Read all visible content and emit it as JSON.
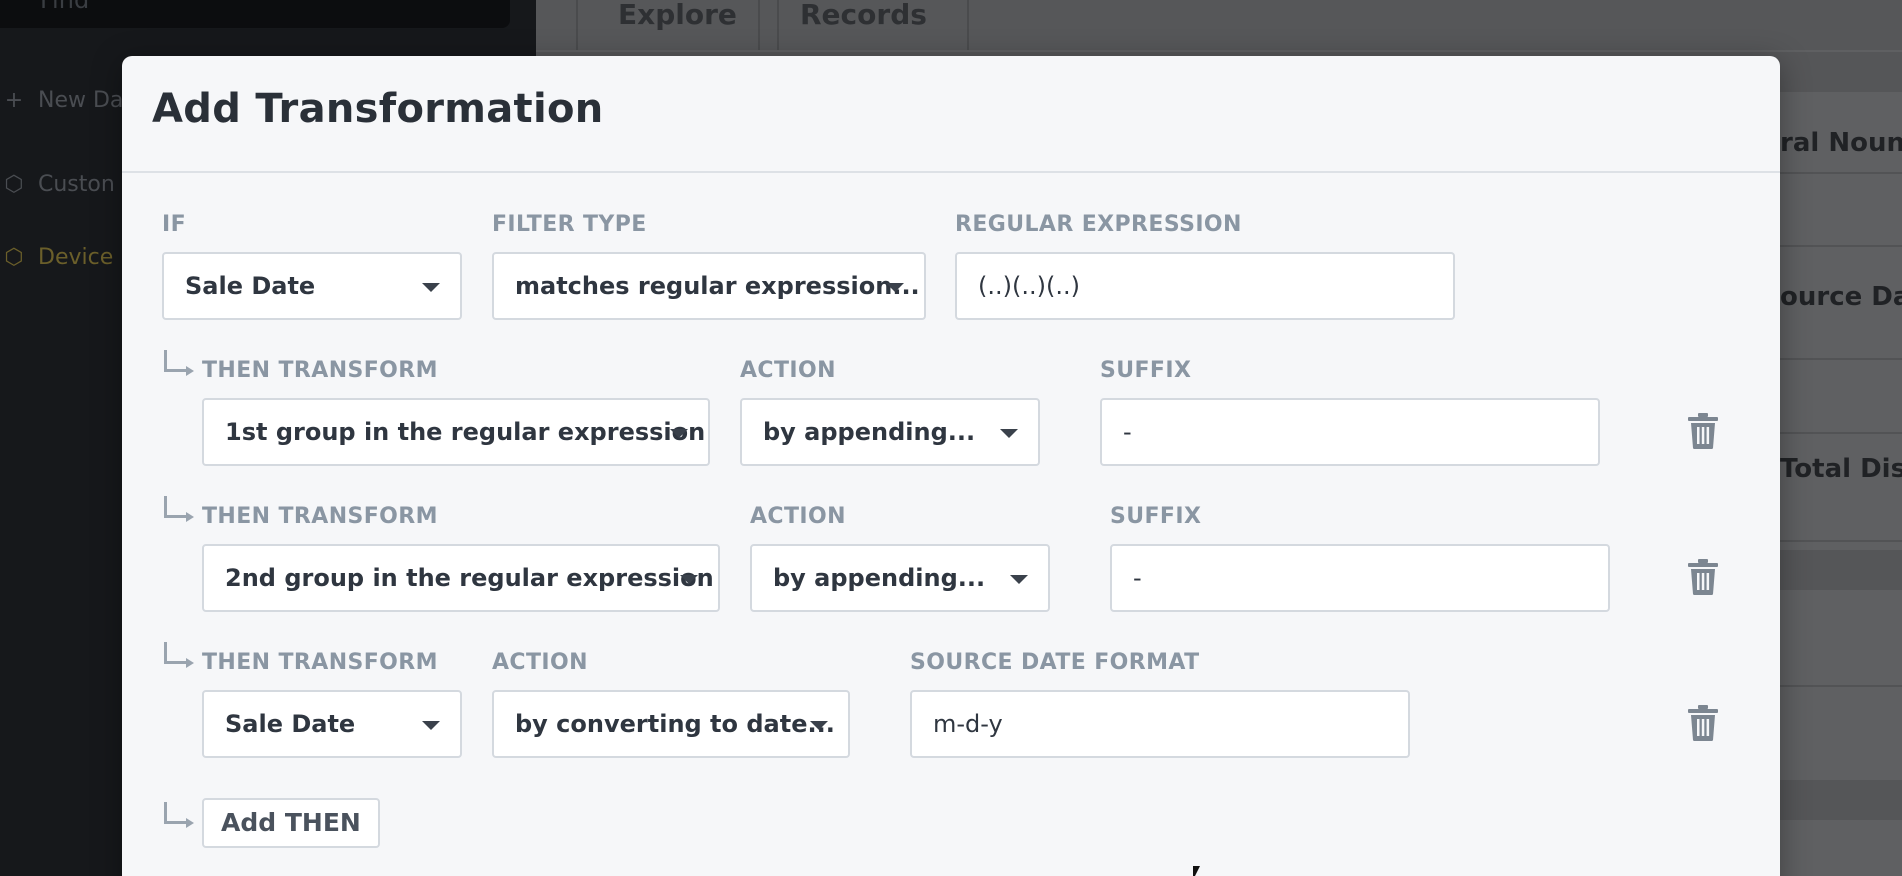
{
  "background": {
    "search_placeholder": "Find",
    "sidebar": {
      "new_dataset": "New Da",
      "items": [
        "Custon",
        "Device"
      ]
    },
    "tabs": [
      "Explore",
      "Records"
    ],
    "column_labels": [
      "ral Noun)",
      "ource Data",
      "Total Disp"
    ]
  },
  "modal": {
    "title": "Add Transformation",
    "if_row": {
      "if_label": "IF",
      "if_value": "Sale Date",
      "filter_type_label": "FILTER TYPE",
      "filter_type_value": "matches regular expression...",
      "regex_label": "REGULAR EXPRESSION",
      "regex_value": "(..)(..)(..)"
    },
    "then_rows": [
      {
        "then_label": "THEN TRANSFORM",
        "then_value": "1st group in the regular expression",
        "action_label": "ACTION",
        "action_value": "by appending...",
        "param_label": "SUFFIX",
        "param_value": "-"
      },
      {
        "then_label": "THEN TRANSFORM",
        "then_value": "2nd group in the regular expression",
        "action_label": "ACTION",
        "action_value": "by appending...",
        "param_label": "SUFFIX",
        "param_value": "-"
      },
      {
        "then_label": "THEN TRANSFORM",
        "then_value": "Sale Date",
        "action_label": "ACTION",
        "action_value": "by converting to date...",
        "param_label": "SOURCE DATE FORMAT",
        "param_value": "m-d-y"
      }
    ],
    "add_then_label": "Add THEN"
  },
  "icons": {
    "arrow": "return-arrow-icon",
    "delete": "trash-icon",
    "caret": "caret-down-icon"
  }
}
